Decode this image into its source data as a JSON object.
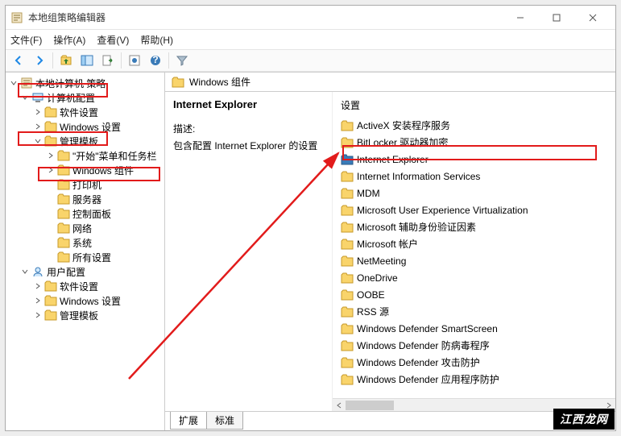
{
  "window": {
    "title": "本地组策略编辑器"
  },
  "menubar": [
    "文件(F)",
    "操作(A)",
    "查看(V)",
    "帮助(H)"
  ],
  "tree": [
    {
      "level": 0,
      "expand": "open",
      "icon": "book",
      "label": "本地计算机 策略"
    },
    {
      "level": 1,
      "expand": "open",
      "icon": "computer",
      "label": "计算机配置",
      "highlight": true
    },
    {
      "level": 2,
      "expand": "closed",
      "icon": "folder",
      "label": "软件设置"
    },
    {
      "level": 2,
      "expand": "closed",
      "icon": "folder",
      "label": "Windows 设置"
    },
    {
      "level": 2,
      "expand": "open",
      "icon": "folder",
      "label": "管理模板",
      "highlight": true
    },
    {
      "level": 3,
      "expand": "closed",
      "icon": "folder",
      "label": "\"开始\"菜单和任务栏"
    },
    {
      "level": 3,
      "expand": "closed",
      "icon": "folder",
      "label": "Windows 组件",
      "highlight": true
    },
    {
      "level": 3,
      "expand": "none",
      "icon": "folder",
      "label": "打印机"
    },
    {
      "level": 3,
      "expand": "none",
      "icon": "folder",
      "label": "服务器"
    },
    {
      "level": 3,
      "expand": "none",
      "icon": "folder",
      "label": "控制面板"
    },
    {
      "level": 3,
      "expand": "none",
      "icon": "folder",
      "label": "网络"
    },
    {
      "level": 3,
      "expand": "none",
      "icon": "folder",
      "label": "系统"
    },
    {
      "level": 3,
      "expand": "none",
      "icon": "folder",
      "label": "所有设置"
    },
    {
      "level": 1,
      "expand": "open",
      "icon": "user",
      "label": "用户配置"
    },
    {
      "level": 2,
      "expand": "closed",
      "icon": "folder",
      "label": "软件设置"
    },
    {
      "level": 2,
      "expand": "closed",
      "icon": "folder",
      "label": "Windows 设置"
    },
    {
      "level": 2,
      "expand": "closed",
      "icon": "folder",
      "label": "管理模板"
    }
  ],
  "path": "Windows 组件",
  "desc": {
    "heading": "Internet Explorer",
    "label": "描述:",
    "text": "包含配置 Internet Explorer 的设置"
  },
  "list": {
    "header": "设置",
    "items": [
      {
        "label": "ActiveX 安装程序服务"
      },
      {
        "label": "BitLocker 驱动器加密"
      },
      {
        "label": "Internet Explorer",
        "selected": true,
        "highlight": true
      },
      {
        "label": "Internet Information Services"
      },
      {
        "label": "MDM"
      },
      {
        "label": "Microsoft User Experience Virtualization"
      },
      {
        "label": "Microsoft 辅助身份验证因素"
      },
      {
        "label": "Microsoft 帐户"
      },
      {
        "label": "NetMeeting"
      },
      {
        "label": "OneDrive"
      },
      {
        "label": "OOBE"
      },
      {
        "label": "RSS 源"
      },
      {
        "label": "Windows Defender SmartScreen"
      },
      {
        "label": "Windows Defender 防病毒程序"
      },
      {
        "label": "Windows Defender 攻击防护"
      },
      {
        "label": "Windows Defender 应用程序防护"
      }
    ]
  },
  "tabs": {
    "extended": "扩展",
    "standard": "标准"
  },
  "watermark": "江西龙网"
}
